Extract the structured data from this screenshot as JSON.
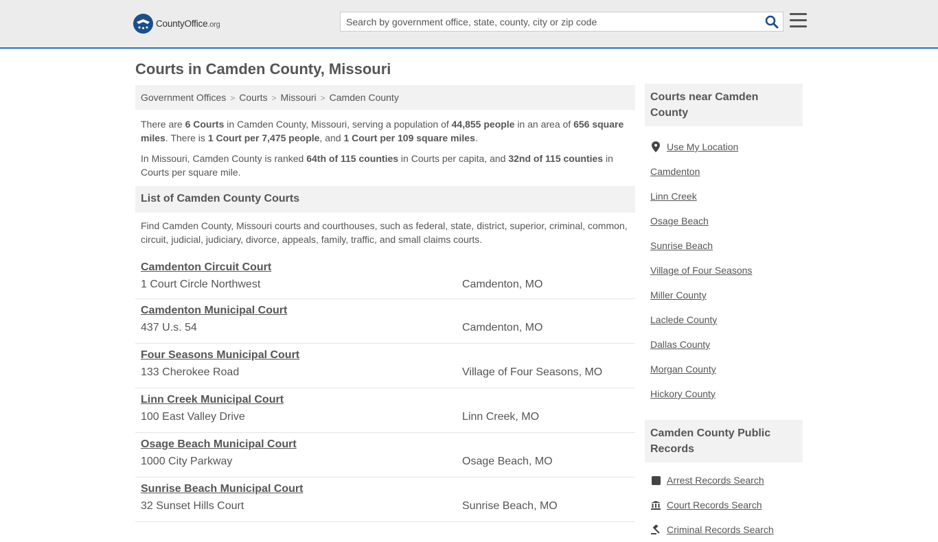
{
  "header": {
    "logo_main": "CountyOffice",
    "logo_tld": ".org",
    "search_placeholder": "Search by government office, state, county, city or zip code"
  },
  "page_title": "Courts in Camden County, Missouri",
  "breadcrumb": [
    "Government Offices",
    "Courts",
    "Missouri",
    "Camden County"
  ],
  "intro": {
    "p1": {
      "t1": "There are ",
      "b1": "6 Courts",
      "t2": " in Camden County, Missouri, serving a population of ",
      "b2": "44,855 people",
      "t3": " in an area of ",
      "b3": "656 square miles",
      "t4": ". There is ",
      "b4": "1 Court per 7,475 people",
      "t5": ", and ",
      "b5": "1 Court per 109 square miles",
      "t6": "."
    },
    "p2": {
      "t1": "In Missouri, Camden County is ranked ",
      "b1": "64th of 115 counties",
      "t2": " in Courts per capita, and ",
      "b2": "32nd of 115 counties",
      "t3": " in Courts per square mile."
    }
  },
  "list_section": {
    "title": "List of Camden County Courts",
    "description": "Find Camden County, Missouri courts and courthouses, such as federal, state, district, superior, criminal, common, circuit, judicial, judiciary, divorce, appeals, family, traffic, and small claims courts."
  },
  "courts": [
    {
      "name": "Camdenton Circuit Court",
      "address": "1 Court Circle Northwest",
      "city": "Camdenton, MO"
    },
    {
      "name": "Camdenton Municipal Court",
      "address": "437 U.s. 54",
      "city": "Camdenton, MO"
    },
    {
      "name": "Four Seasons Municipal Court",
      "address": "133 Cherokee Road",
      "city": "Village of Four Seasons, MO"
    },
    {
      "name": "Linn Creek Municipal Court",
      "address": "100 East Valley Drive",
      "city": "Linn Creek, MO"
    },
    {
      "name": "Osage Beach Municipal Court",
      "address": "1000 City Parkway",
      "city": "Osage Beach, MO"
    },
    {
      "name": "Sunrise Beach Municipal Court",
      "address": "32 Sunset Hills Court",
      "city": "Sunrise Beach, MO"
    }
  ],
  "sidebar": {
    "nearby_title": "Courts near Camden County",
    "use_location": "Use My Location",
    "nearby": [
      "Camdenton",
      "Linn Creek",
      "Osage Beach",
      "Sunrise Beach",
      "Village of Four Seasons",
      "Miller County",
      "Laclede County",
      "Dallas County",
      "Morgan County",
      "Hickory County"
    ],
    "records_title": "Camden County Public Records",
    "records": [
      {
        "label": "Arrest Records Search",
        "icon": "square-icon"
      },
      {
        "label": "Court Records Search",
        "icon": "courthouse-icon"
      },
      {
        "label": "Criminal Records Search",
        "icon": "gavel-icon"
      }
    ]
  }
}
